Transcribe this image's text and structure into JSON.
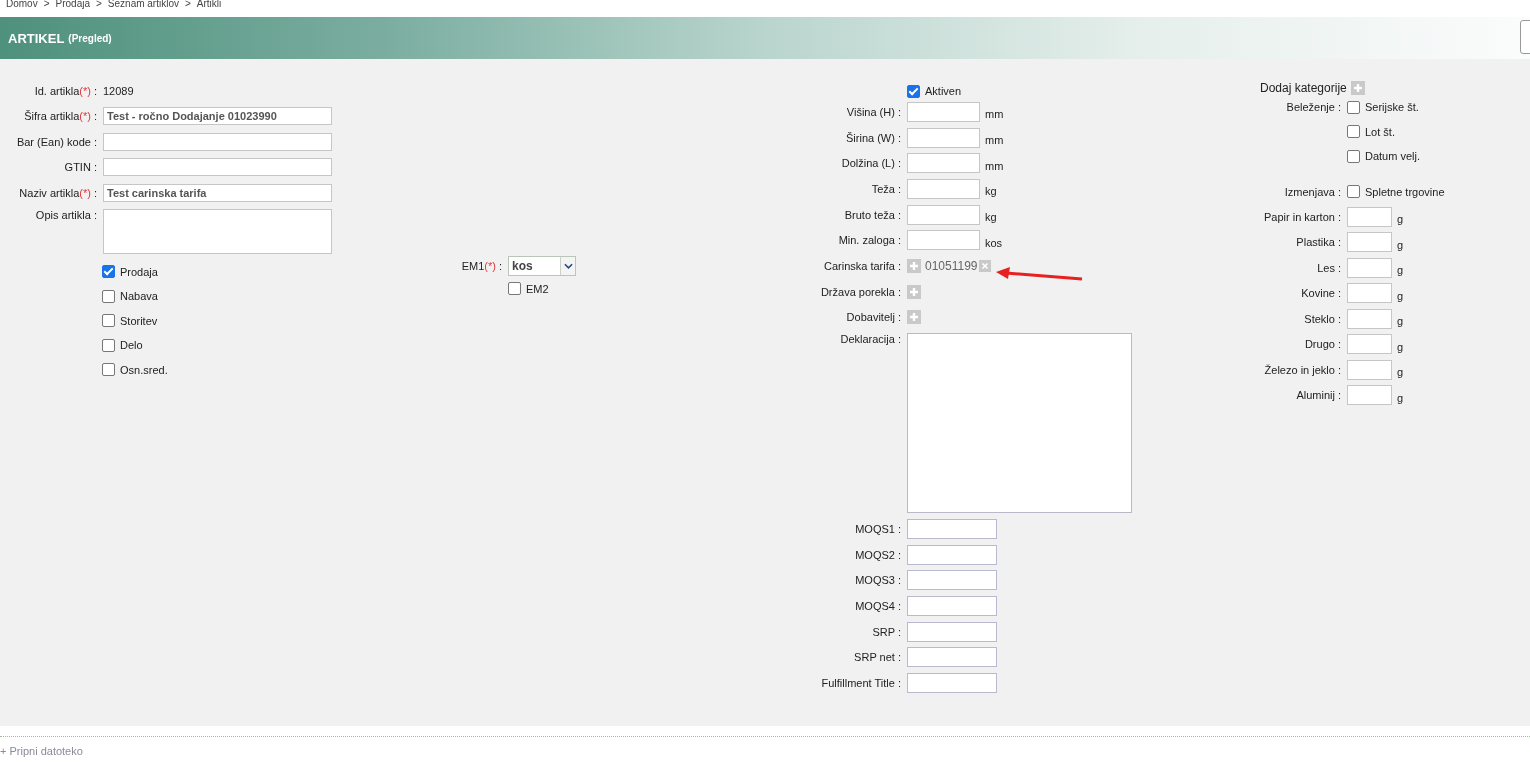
{
  "breadcrumb": {
    "separator": ">",
    "items": [
      "Domov",
      "Prodaja",
      "Seznam artiklov",
      "Artikli"
    ]
  },
  "header": {
    "title": "ARTIKEL",
    "subtitle": "(Pregled)"
  },
  "required_mark": "(*)",
  "colon": ":",
  "basic_fields": [
    {
      "label": "Id. artikla",
      "required": true,
      "kind": "text",
      "value": "12089"
    },
    {
      "label": "Šifra artikla",
      "required": true,
      "kind": "input",
      "value": "Test - ročno Dodajanje 01023990"
    },
    {
      "label": "Bar (Ean) kode",
      "required": false,
      "kind": "input"
    },
    {
      "label": "GTIN",
      "required": false,
      "kind": "input"
    },
    {
      "label": "Naziv artikla",
      "required": true,
      "kind": "input",
      "value": "Test carinska tarifa"
    },
    {
      "label": "Opis artikla",
      "required": false,
      "kind": "textarea"
    }
  ],
  "types": [
    {
      "label": "Prodaja",
      "checked": true
    },
    {
      "label": "Nabava",
      "checked": false
    },
    {
      "label": "Storitev",
      "checked": false
    },
    {
      "label": "Delo",
      "checked": false
    },
    {
      "label": "Osn.sred.",
      "checked": false
    }
  ],
  "units": {
    "em1": {
      "label": "EM1",
      "required": true,
      "value": "kos"
    },
    "em2": {
      "label": "EM2",
      "checked": false
    }
  },
  "active": {
    "label": "Aktiven",
    "checked": true
  },
  "details": [
    {
      "label": "Višina (H)",
      "kind": "input",
      "unit": "mm"
    },
    {
      "label": "Širina (W)",
      "kind": "input",
      "unit": "mm"
    },
    {
      "label": "Dolžina (L)",
      "kind": "input",
      "unit": "mm"
    },
    {
      "label": "Teža",
      "kind": "input",
      "unit": "kg"
    },
    {
      "label": "Bruto teža",
      "kind": "input",
      "unit": "kg"
    },
    {
      "label": "Min. zaloga",
      "kind": "input",
      "unit": "kos"
    },
    {
      "label": "Carinska tarifa",
      "kind": "picker",
      "value": "01051199"
    },
    {
      "label": "Država porekla",
      "kind": "picker"
    },
    {
      "label": "Dobavitelj",
      "kind": "picker"
    },
    {
      "label": "Deklaracija",
      "kind": "textarea"
    },
    {
      "label": "MOQS1",
      "kind": "wide"
    },
    {
      "label": "MOQS2",
      "kind": "wide"
    },
    {
      "label": "MOQS3",
      "kind": "wide"
    },
    {
      "label": "MOQS4",
      "kind": "wide"
    },
    {
      "label": "SRP",
      "kind": "wide"
    },
    {
      "label": "SRP net",
      "kind": "wide"
    },
    {
      "label": "Fulfillment Title",
      "kind": "wide"
    }
  ],
  "categories": {
    "label": "Dodaj kategorije"
  },
  "tracking": {
    "label": "Beleženje",
    "options": [
      {
        "label": "Serijske št.",
        "checked": false
      },
      {
        "label": "Lot št.",
        "checked": false
      },
      {
        "label": "Datum velj.",
        "checked": false
      }
    ]
  },
  "exchange": {
    "label": "Izmenjava",
    "options": [
      {
        "label": "Spletne trgovine",
        "checked": false
      }
    ]
  },
  "packaging": [
    {
      "label": "Papir in karton",
      "unit": "g"
    },
    {
      "label": "Plastika",
      "unit": "g"
    },
    {
      "label": "Les",
      "unit": "g"
    },
    {
      "label": "Kovine",
      "unit": "g"
    },
    {
      "label": "Steklo",
      "unit": "g"
    },
    {
      "label": "Drugo",
      "unit": "g"
    },
    {
      "label": "Železo in jeklo",
      "unit": "g"
    },
    {
      "label": "Aluminij",
      "unit": "g"
    }
  ],
  "attach_link": "+ Pripni datoteko"
}
